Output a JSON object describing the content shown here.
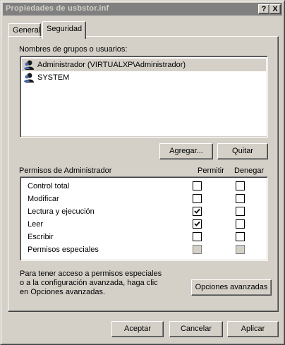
{
  "window": {
    "title": "Propiedades de usbstor.inf",
    "help_btn": "?",
    "close_btn": "X"
  },
  "tabs": [
    {
      "label": "General",
      "active": false
    },
    {
      "label": "Seguridad",
      "active": true
    }
  ],
  "users_section": {
    "label": "Nombres de grupos o usuarios:",
    "items": [
      {
        "name": "Administrador (VIRTUALXP\\Administrador)",
        "icon": "user-icon",
        "selected": true
      },
      {
        "name": "SYSTEM",
        "icon": "user-icon",
        "selected": false
      }
    ],
    "add_button": "Agregar...",
    "remove_button": "Quitar"
  },
  "permissions": {
    "label": "Permisos de Administrador",
    "allow_header": "Permitir",
    "deny_header": "Denegar",
    "rows": [
      {
        "name": "Control total",
        "allow": false,
        "deny": false,
        "disabled": false
      },
      {
        "name": "Modificar",
        "allow": false,
        "deny": false,
        "disabled": false
      },
      {
        "name": "Lectura y ejecución",
        "allow": true,
        "deny": false,
        "disabled": false
      },
      {
        "name": "Leer",
        "allow": true,
        "deny": false,
        "disabled": false
      },
      {
        "name": "Escribir",
        "allow": false,
        "deny": false,
        "disabled": false
      },
      {
        "name": "Permisos especiales",
        "allow": false,
        "deny": false,
        "disabled": true
      }
    ]
  },
  "advanced": {
    "note_line1": "Para tener acceso a permisos especiales",
    "note_line2": "o a la configuración avanzada, haga clic",
    "note_line3": "en Opciones avanzadas.",
    "button": "Opciones avanzadas"
  },
  "footer": {
    "ok": "Aceptar",
    "cancel": "Cancelar",
    "apply": "Aplicar"
  }
}
